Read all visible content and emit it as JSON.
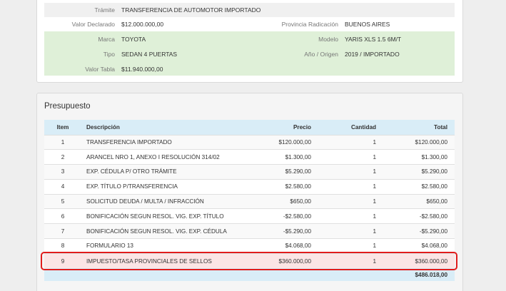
{
  "vehicle": {
    "tramite_label": "Trámite",
    "tramite_value": "TRANSFERENCIA DE AUTOMOTOR IMPORTADO",
    "valor_declarado_label": "Valor Declarado",
    "valor_declarado_value": "$12.000.000,00",
    "provincia_label": "Provincia Radicación",
    "provincia_value": "BUENOS AIRES",
    "marca_label": "Marca",
    "marca_value": "TOYOTA",
    "modelo_label": "Modelo",
    "modelo_value": "YARIS XLS 1.5 6M/T",
    "tipo_label": "Tipo",
    "tipo_value": "SEDAN 4 PUERTAS",
    "anio_label": "Año / Origen",
    "anio_value": "2019 / IMPORTADO",
    "valor_tabla_label": "Valor Tabla",
    "valor_tabla_value": "$11.940.000,00"
  },
  "presupuesto": {
    "title": "Presupuesto",
    "headers": {
      "item": "Item",
      "descripcion": "Descripción",
      "precio": "Precio",
      "cantidad": "Cantidad",
      "total": "Total"
    },
    "rows": [
      {
        "item": "1",
        "descripcion": "TRANSFERENCIA IMPORTADO",
        "precio": "$120.000,00",
        "cantidad": "1",
        "total": "$120.000,00"
      },
      {
        "item": "2",
        "descripcion": "ARANCEL NRO 1, ANEXO I RESOLUCIÓN 314/02",
        "precio": "$1.300,00",
        "cantidad": "1",
        "total": "$1.300,00"
      },
      {
        "item": "3",
        "descripcion": "EXP. CÉDULA P/ OTRO TRÁMITE",
        "precio": "$5.290,00",
        "cantidad": "1",
        "total": "$5.290,00"
      },
      {
        "item": "4",
        "descripcion": "EXP. TÍTULO P/TRANSFERENCIA",
        "precio": "$2.580,00",
        "cantidad": "1",
        "total": "$2.580,00"
      },
      {
        "item": "5",
        "descripcion": "SOLICITUD DEUDA / MULTA / INFRACCIÓN",
        "precio": "$650,00",
        "cantidad": "1",
        "total": "$650,00"
      },
      {
        "item": "6",
        "descripcion": "BONIFICACIÓN SEGUN RESOL. VIG. EXP. TÍTULO",
        "precio": "-$2.580,00",
        "cantidad": "1",
        "total": "-$2.580,00"
      },
      {
        "item": "7",
        "descripcion": "BONIFICACIÓN SEGUN RESOL. VIG. EXP. CÉDULA",
        "precio": "-$5.290,00",
        "cantidad": "1",
        "total": "-$5.290,00"
      },
      {
        "item": "8",
        "descripcion": "FORMULARIO 13",
        "precio": "$4.068,00",
        "cantidad": "1",
        "total": "$4.068,00"
      },
      {
        "item": "9",
        "descripcion": "IMPUESTO/TASA PROVINCIALES DE SELLOS",
        "precio": "$360.000,00",
        "cantidad": "1",
        "total": "$360.000,00"
      }
    ],
    "grand_total": "$486.018,00"
  }
}
